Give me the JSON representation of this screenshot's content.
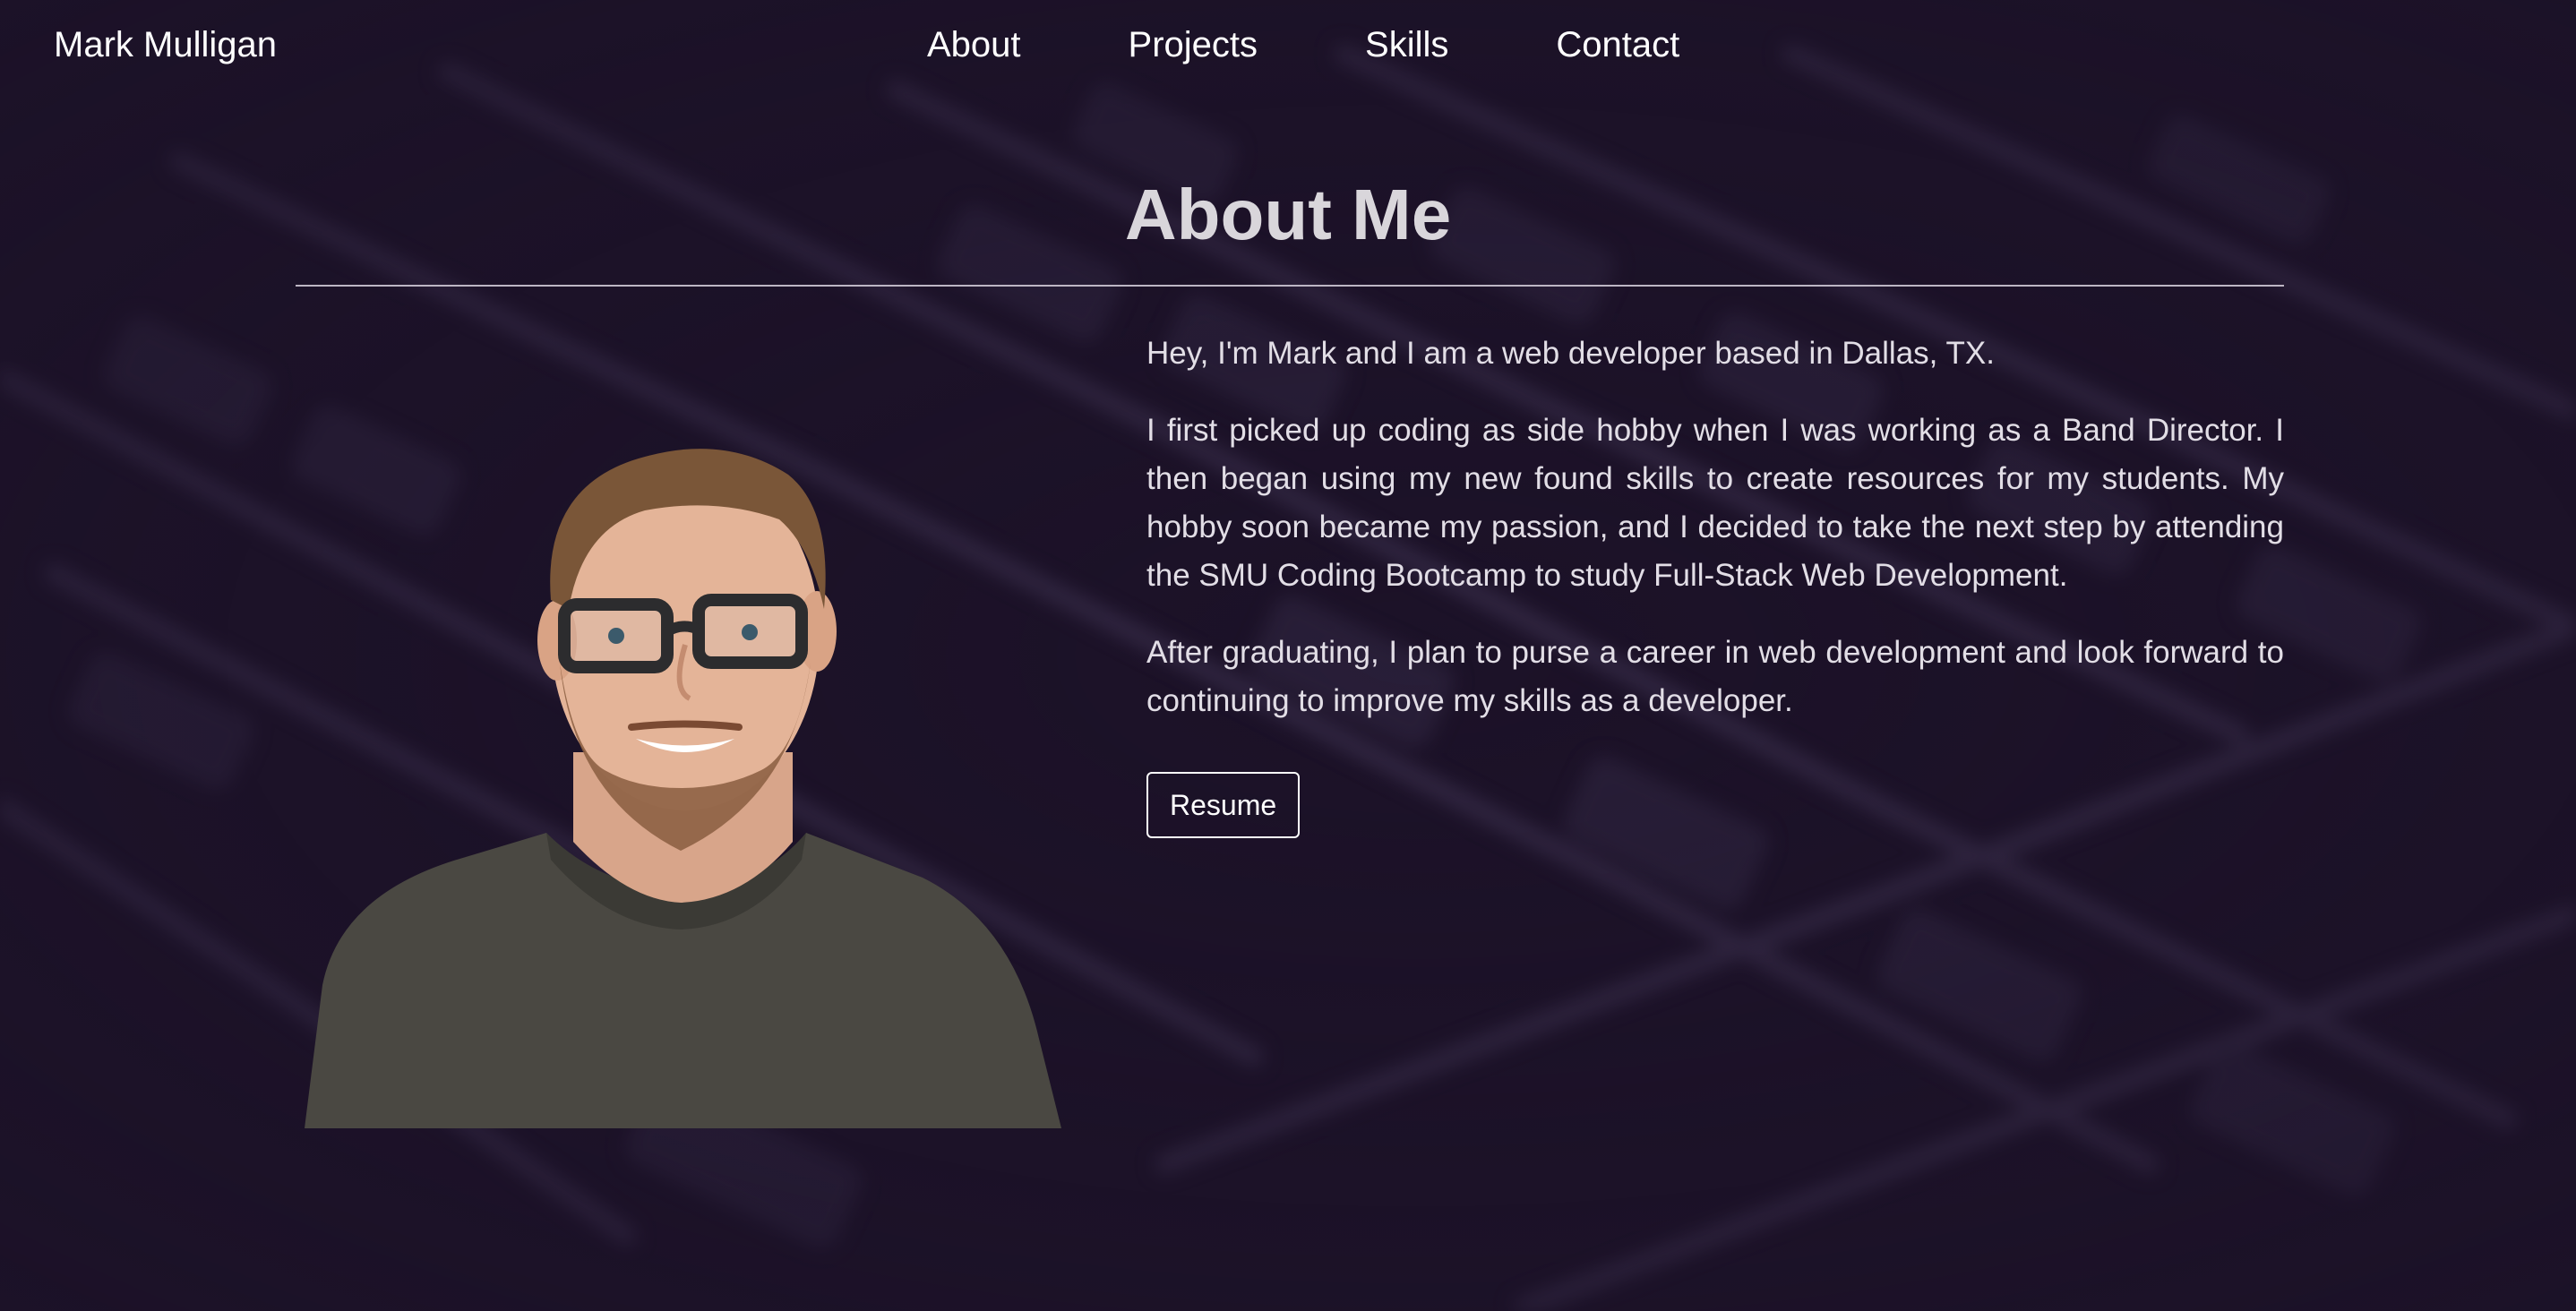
{
  "nav": {
    "brand": "Mark Mulligan",
    "links": [
      {
        "label": "About"
      },
      {
        "label": "Projects"
      },
      {
        "label": "Skills"
      },
      {
        "label": "Contact"
      }
    ]
  },
  "about": {
    "heading": "About Me",
    "paragraphs": [
      "Hey, I'm Mark and I am a web developer based in Dallas, TX.",
      "I first picked up coding as side hobby when I was working as a Band Director. I then began using my new found skills to create resources for my students. My hobby soon became my passion, and I decided to take the next step by attending the SMU Coding Bootcamp to study Full-Stack Web Development.",
      "After graduating, I plan to purse a career in web development and look forward to continuing to improve my skills as a developer."
    ],
    "resume_label": "Resume"
  },
  "colors": {
    "background": "#1c1228",
    "text": "#e2dee6",
    "heading": "#d9d6db",
    "nav_text": "#ffffff"
  }
}
